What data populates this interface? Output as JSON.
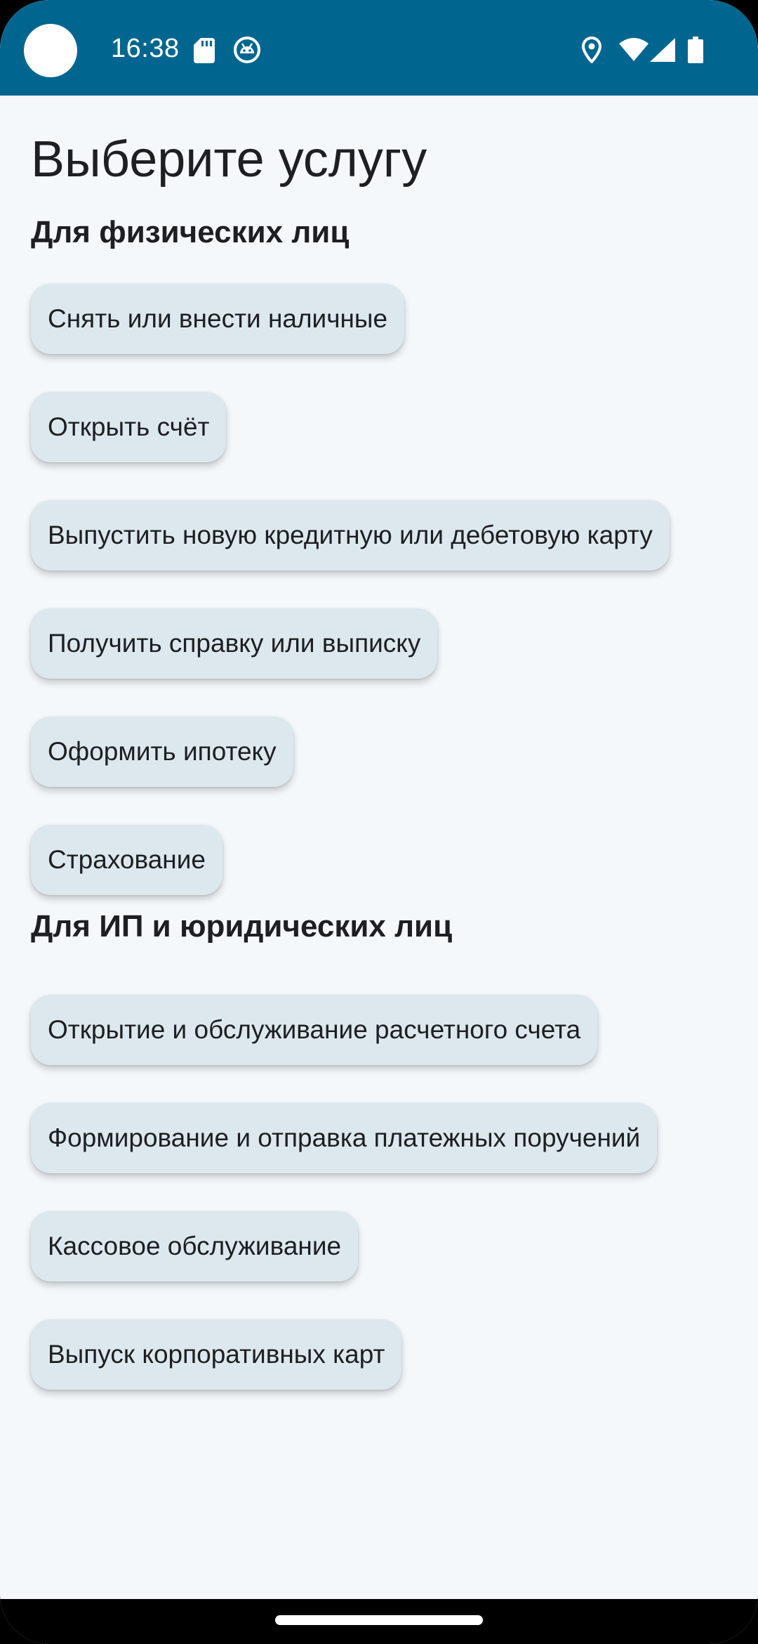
{
  "status_bar": {
    "time": "16:38",
    "left_icons": [
      "sd-card-icon",
      "debug-icon"
    ],
    "right_icons": [
      "location-icon",
      "wifi-icon",
      "signal-icon",
      "battery-icon"
    ],
    "color": "#006690"
  },
  "main": {
    "title": "Выберите услугу",
    "sections": [
      {
        "title": "Для физических лиц",
        "items": [
          "Снять или внести наличные",
          "Открыть счёт",
          "Выпустить новую кредитную или дебетовую карту",
          "Получить справку или выписку",
          "Оформить ипотеку",
          "Страхование"
        ]
      },
      {
        "title": "Для ИП и юридических лиц",
        "items": [
          "Открытие и обслуживание расчетного счета",
          "Формирование и отправка платежных поручений",
          "Кассовое обслуживание",
          "Выпуск корпоративных карт"
        ]
      }
    ]
  },
  "colors": {
    "background": "#f4f8fb",
    "chip": "#dde8ee",
    "text": "#1d1f22"
  }
}
